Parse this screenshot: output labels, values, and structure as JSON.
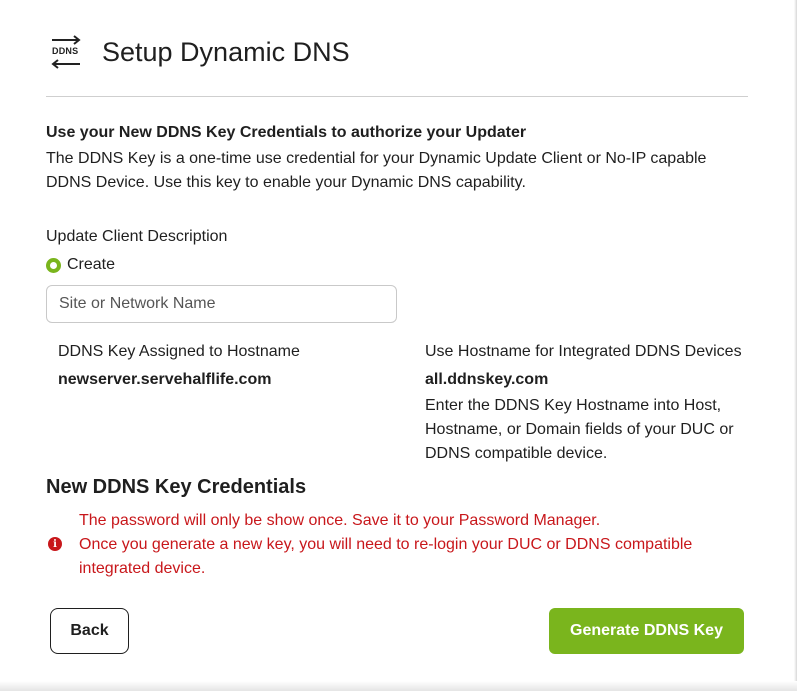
{
  "header": {
    "icon_text": "DDNS",
    "title": "Setup Dynamic DNS"
  },
  "intro": {
    "heading": "Use your New DDNS Key Credentials to authorize your Updater",
    "text": "The DDNS Key is a one-time use credential for your Dynamic Update Client or No-IP capable DDNS Device. Use this key to enable your Dynamic DNS capability."
  },
  "update_client": {
    "label": "Update Client Description",
    "radio_label": "Create",
    "input_placeholder": "Site or Network Name",
    "input_value": ""
  },
  "assigned_hostname": {
    "label": "DDNS Key Assigned to Hostname",
    "value": "newserver.servehalflife.com"
  },
  "integrated_hostname": {
    "label": "Use Hostname for Integrated DDNS Devices",
    "value": "all.ddnskey.com",
    "description": "Enter the DDNS Key Hostname into Host, Hostname, or Domain fields of your DUC or DDNS compatible device."
  },
  "credentials": {
    "heading": "New DDNS Key Credentials",
    "warning_line1": "The password will only be show once. Save it to your Password Manager.",
    "warning_line2": "Once you generate a new key, you will need to re-login your DUC or DDNS compatible integrated device.",
    "warning_icon": "info-icon"
  },
  "buttons": {
    "back": "Back",
    "generate": "Generate DDNS Key"
  },
  "colors": {
    "accent_green": "#7ab51d",
    "warning_red": "#c8171b"
  }
}
